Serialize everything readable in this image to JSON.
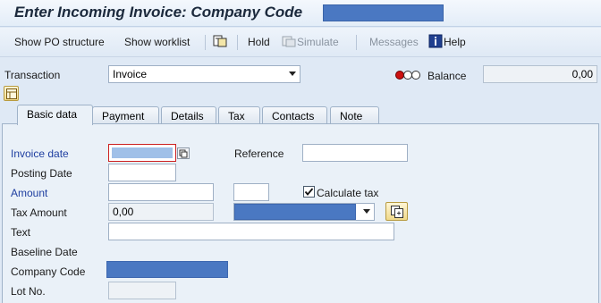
{
  "window": {
    "title": "Enter Incoming Invoice: Company Code"
  },
  "toolbar": {
    "show_po_structure": "Show PO structure",
    "show_worklist": "Show worklist",
    "hold": "Hold",
    "simulate": "Simulate",
    "messages": "Messages",
    "help": "Help"
  },
  "header": {
    "transaction_label": "Transaction",
    "transaction_value": "Invoice",
    "balance_label": "Balance",
    "balance_value": "0,00"
  },
  "tabs": [
    "Basic data",
    "Payment",
    "Details",
    "Tax",
    "Contacts",
    "Note"
  ],
  "form": {
    "invoice_date_label": "Invoice date",
    "reference_label": "Reference",
    "posting_date_label": "Posting Date",
    "amount_label": "Amount",
    "calculate_tax_label": "Calculate tax",
    "calculate_tax_checked": true,
    "tax_amount_label": "Tax Amount",
    "tax_amount_value": "0,00",
    "text_label": "Text",
    "baseline_date_label": "Baseline Date",
    "company_code_label": "Company Code",
    "lot_no_label": "Lot No."
  },
  "colors": {
    "redaction": "#4a78c2",
    "required_label": "#1e3ea0",
    "status_red": "#cc1010"
  },
  "icons": [
    "po-structure-icon",
    "simulate-icon",
    "help-book-icon",
    "status-lights-icon",
    "layout-toggle-icon",
    "calendar-copy-icon",
    "tax-code-details-icon"
  ]
}
